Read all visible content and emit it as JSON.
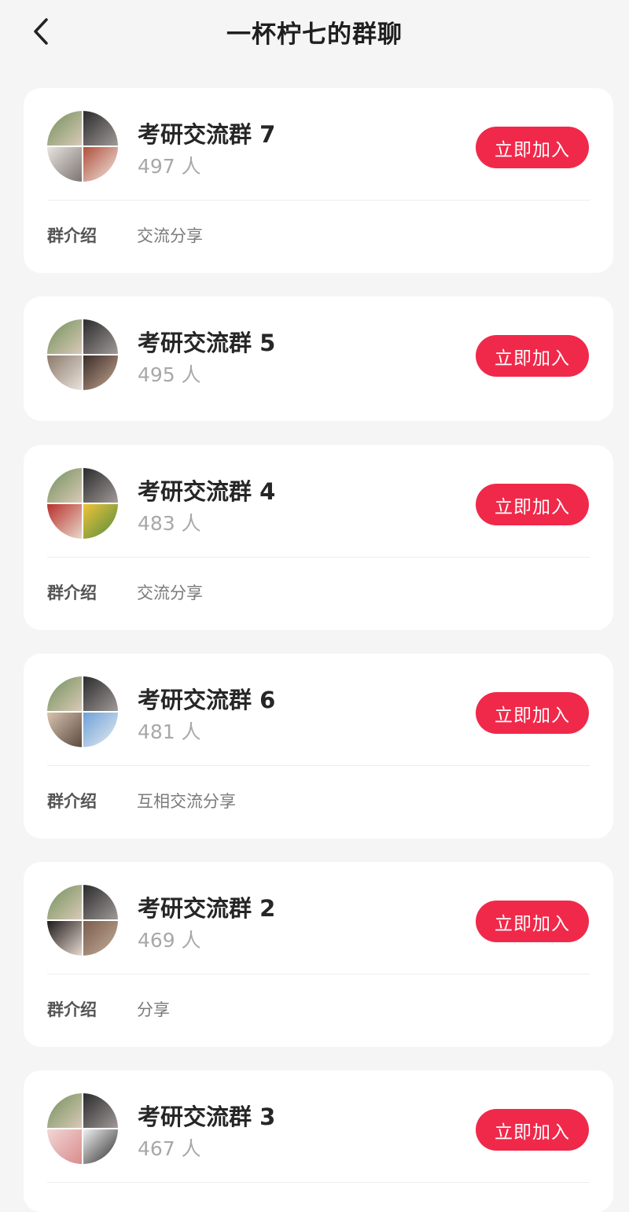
{
  "header": {
    "title": "一杯柠七的群聊",
    "back_icon": "chevron-left-icon"
  },
  "intro_label": "群介绍",
  "join_label": "立即加入",
  "groups": [
    {
      "name": "考研交流群 7",
      "count": "497 人",
      "intro": "交流分享"
    },
    {
      "name": "考研交流群 5",
      "count": "495 人",
      "intro": ""
    },
    {
      "name": "考研交流群 4",
      "count": "483 人",
      "intro": "交流分享"
    },
    {
      "name": "考研交流群 6",
      "count": "481 人",
      "intro": "互相交流分享"
    },
    {
      "name": "考研交流群 2",
      "count": "469 人",
      "intro": "分享"
    },
    {
      "name": "考研交流群 3",
      "count": "467 人",
      "intro": ""
    }
  ],
  "colors": {
    "accent": "#f0294a",
    "background": "#f5f5f5",
    "card": "#ffffff"
  }
}
